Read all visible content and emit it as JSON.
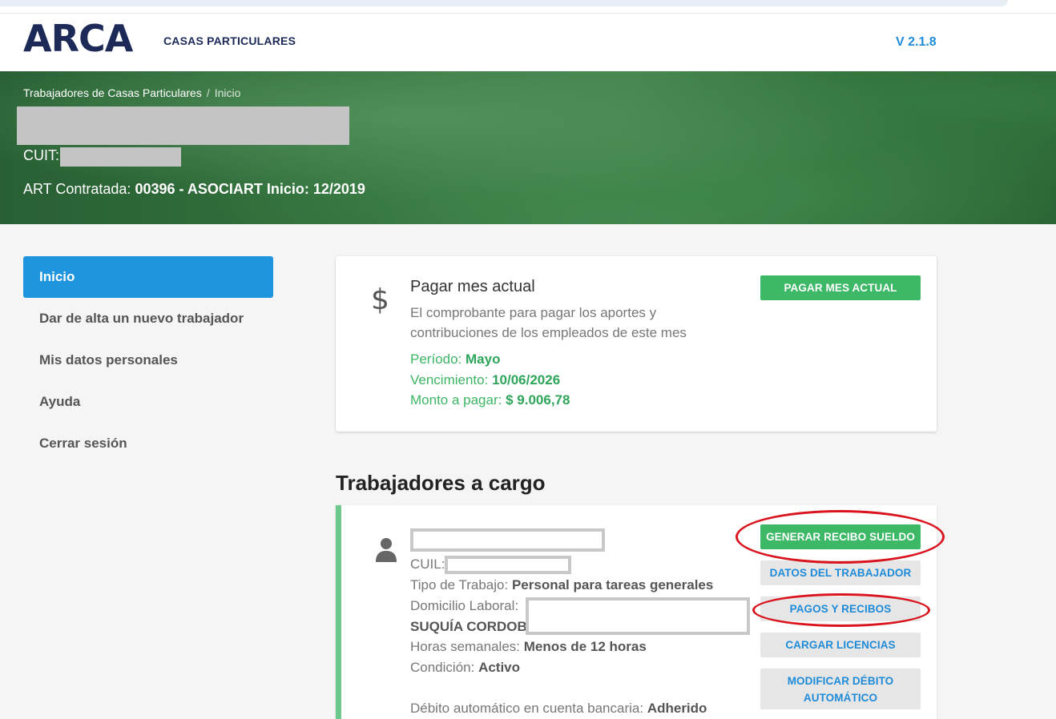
{
  "header": {
    "logo": "ARCA",
    "subtitle": "CASAS PARTICULARES",
    "version": "V 2.1.8"
  },
  "hero": {
    "breadcrumb": [
      "Trabajadores de Casas Particulares",
      "Inicio"
    ],
    "cuit_label": "CUIT:",
    "art_label": "ART Contratada:",
    "art_value": "00396 - ASOCIART Inicio: 12/2019"
  },
  "sidebar": {
    "items": [
      {
        "label": "Inicio",
        "active": true
      },
      {
        "label": "Dar de alta un nuevo trabajador"
      },
      {
        "label": "Mis datos personales"
      },
      {
        "label": "Ayuda"
      },
      {
        "label": "Cerrar sesión"
      }
    ]
  },
  "pay_card": {
    "icon": "dollar-icon",
    "title": "Pagar mes actual",
    "description": "El comprobante para pagar los aportes y contribuciones de los empleados de este mes",
    "period_label": "Período:",
    "period_value": "Mayo",
    "due_label": "Vencimiento:",
    "due_value": "10/06/2026",
    "amount_label": "Monto a pagar:",
    "amount_value": "$ 9.006,78",
    "button": "PAGAR MES ACTUAL"
  },
  "workers": {
    "title": "Trabajadores a cargo",
    "items": [
      {
        "cuil_label": "CUIL:",
        "tipo_label": "Tipo de Trabajo:",
        "tipo_value": "Personal para tareas generales",
        "domicilio_label": "Domicilio Laboral:",
        "domicilio_value": "SUQUÍA CORDOBA",
        "horas_label": "Horas semanales:",
        "horas_value": "Menos de 12 horas",
        "condicion_label": "Condición:",
        "condicion_value": "Activo",
        "debito_label": "Débito automático en cuenta bancaria:",
        "debito_value": "Adherido",
        "buttons": {
          "generar": "GENERAR RECIBO SUELDO",
          "datos": "DATOS DEL TRABAJADOR",
          "pagos": "PAGOS Y RECIBOS",
          "licencias": "CARGAR LICENCIAS",
          "debito_line1": "MODIFICAR DÉBITO",
          "debito_line2": "AUTOMÁTICO"
        }
      }
    ]
  },
  "colors": {
    "brand_navy": "#1d2a57",
    "accent_blue": "#1f95df",
    "green": "#3cb866",
    "annotation_red": "#d9141e"
  }
}
